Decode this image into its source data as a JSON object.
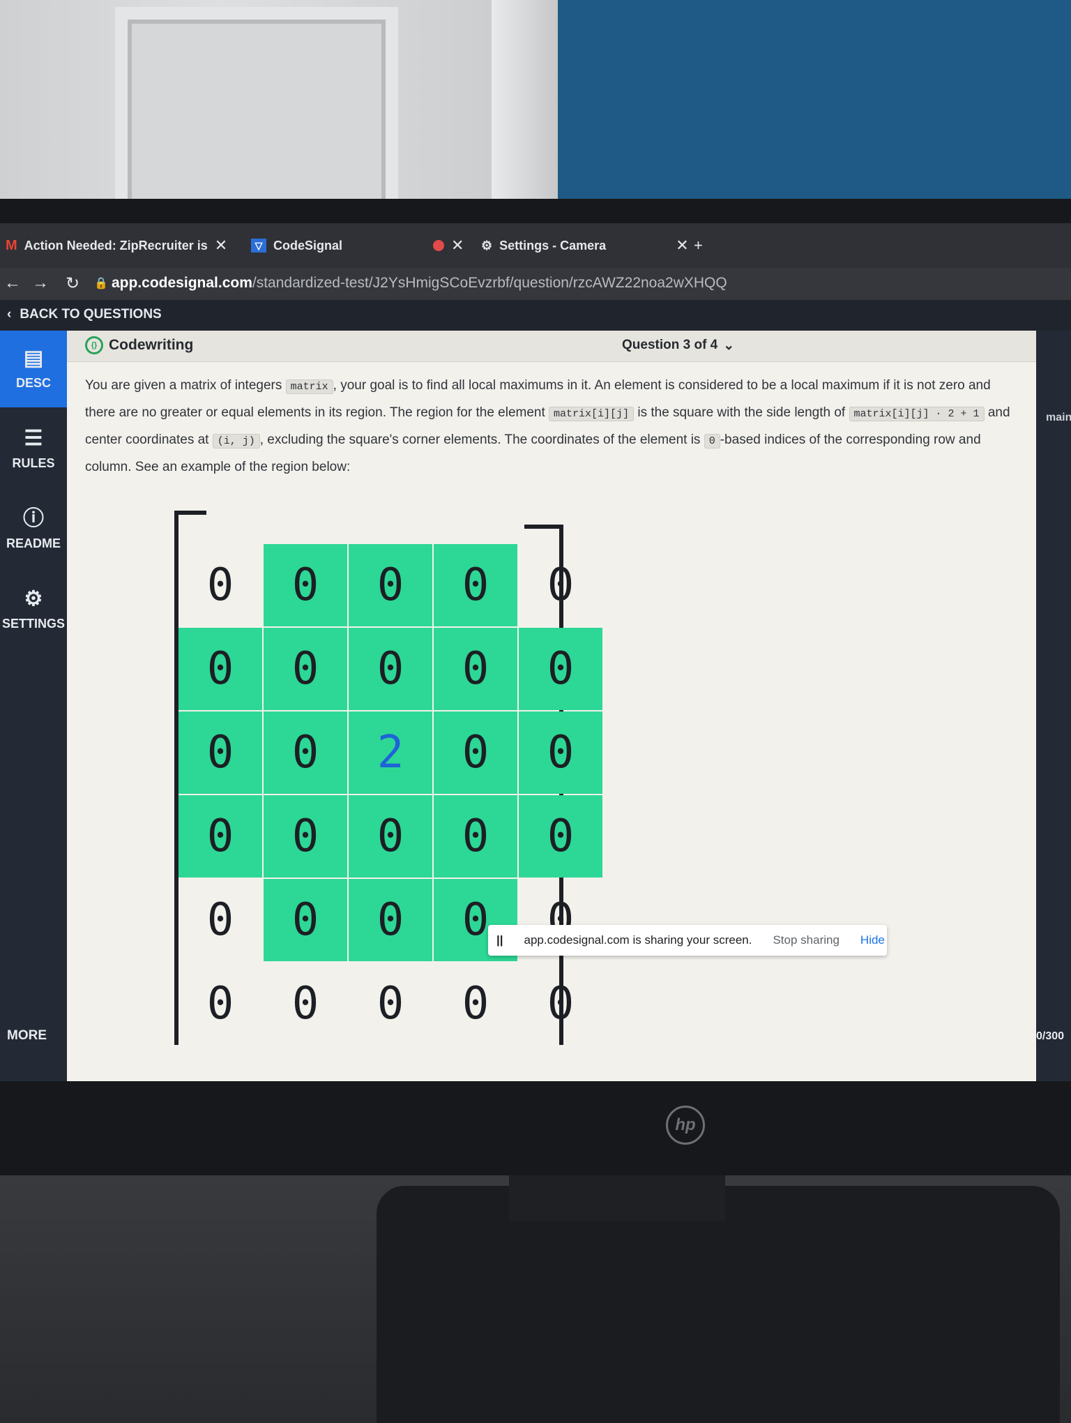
{
  "browser": {
    "tabs": [
      {
        "label": "Action Needed: ZipRecruiter is"
      },
      {
        "label": "CodeSignal"
      },
      {
        "label": "Settings - Camera"
      }
    ],
    "url_host": "app.codesignal.com",
    "url_path": "/standardized-test/J2YsHmigSCoEvzrbf/question/rzcAWZ22noa2wXHQQ"
  },
  "header": {
    "back_label": "BACK TO QUESTIONS"
  },
  "sidebar": {
    "items": [
      {
        "label": "DESC",
        "icon": "document-icon"
      },
      {
        "label": "RULES",
        "icon": "list-icon"
      },
      {
        "label": "README",
        "icon": "info-icon"
      },
      {
        "label": "SETTINGS",
        "icon": "gear-icon"
      }
    ],
    "more_label": "MORE"
  },
  "content": {
    "title": "Codewriting",
    "question_nav": "Question 3 of 4",
    "description": {
      "p1": "You are given a matrix of integers",
      "code1": "matrix",
      "p2": ", your goal is to find all local maximums in it. An element is considered to be a local maximum if it is not zero and there are no greater or equal elements in its region. The region for the element",
      "code2": "matrix[i][j]",
      "p3": "is the square with the side length of",
      "code3": "matrix[i][j] · 2 + 1",
      "p4": "and center coordinates at",
      "code4": "(i, j)",
      "p5": ", excluding the square's corner elements. The coordinates of the element is",
      "code5": "0",
      "p6": "-based indices of the corresponding row and column. See an example of the region below:"
    },
    "matrix": [
      [
        "0",
        "0",
        "0",
        "0",
        "0"
      ],
      [
        "0",
        "0",
        "0",
        "0",
        "0"
      ],
      [
        "0",
        "0",
        "2",
        "0",
        "0"
      ],
      [
        "0",
        "0",
        "0",
        "0",
        "0"
      ],
      [
        "0",
        "0",
        "0",
        "0",
        "0"
      ],
      [
        "0",
        "0",
        "0",
        "0",
        "0"
      ]
    ]
  },
  "right_panel": {
    "label": "main",
    "count": "0/300"
  },
  "share_bar": {
    "message": "app.codesignal.com is sharing your screen.",
    "stop_label": "Stop sharing",
    "hide_label": "Hide"
  },
  "colors": {
    "highlight": "#2dd795",
    "accent": "#1f6fe0",
    "center_value": "#1f63d8"
  }
}
